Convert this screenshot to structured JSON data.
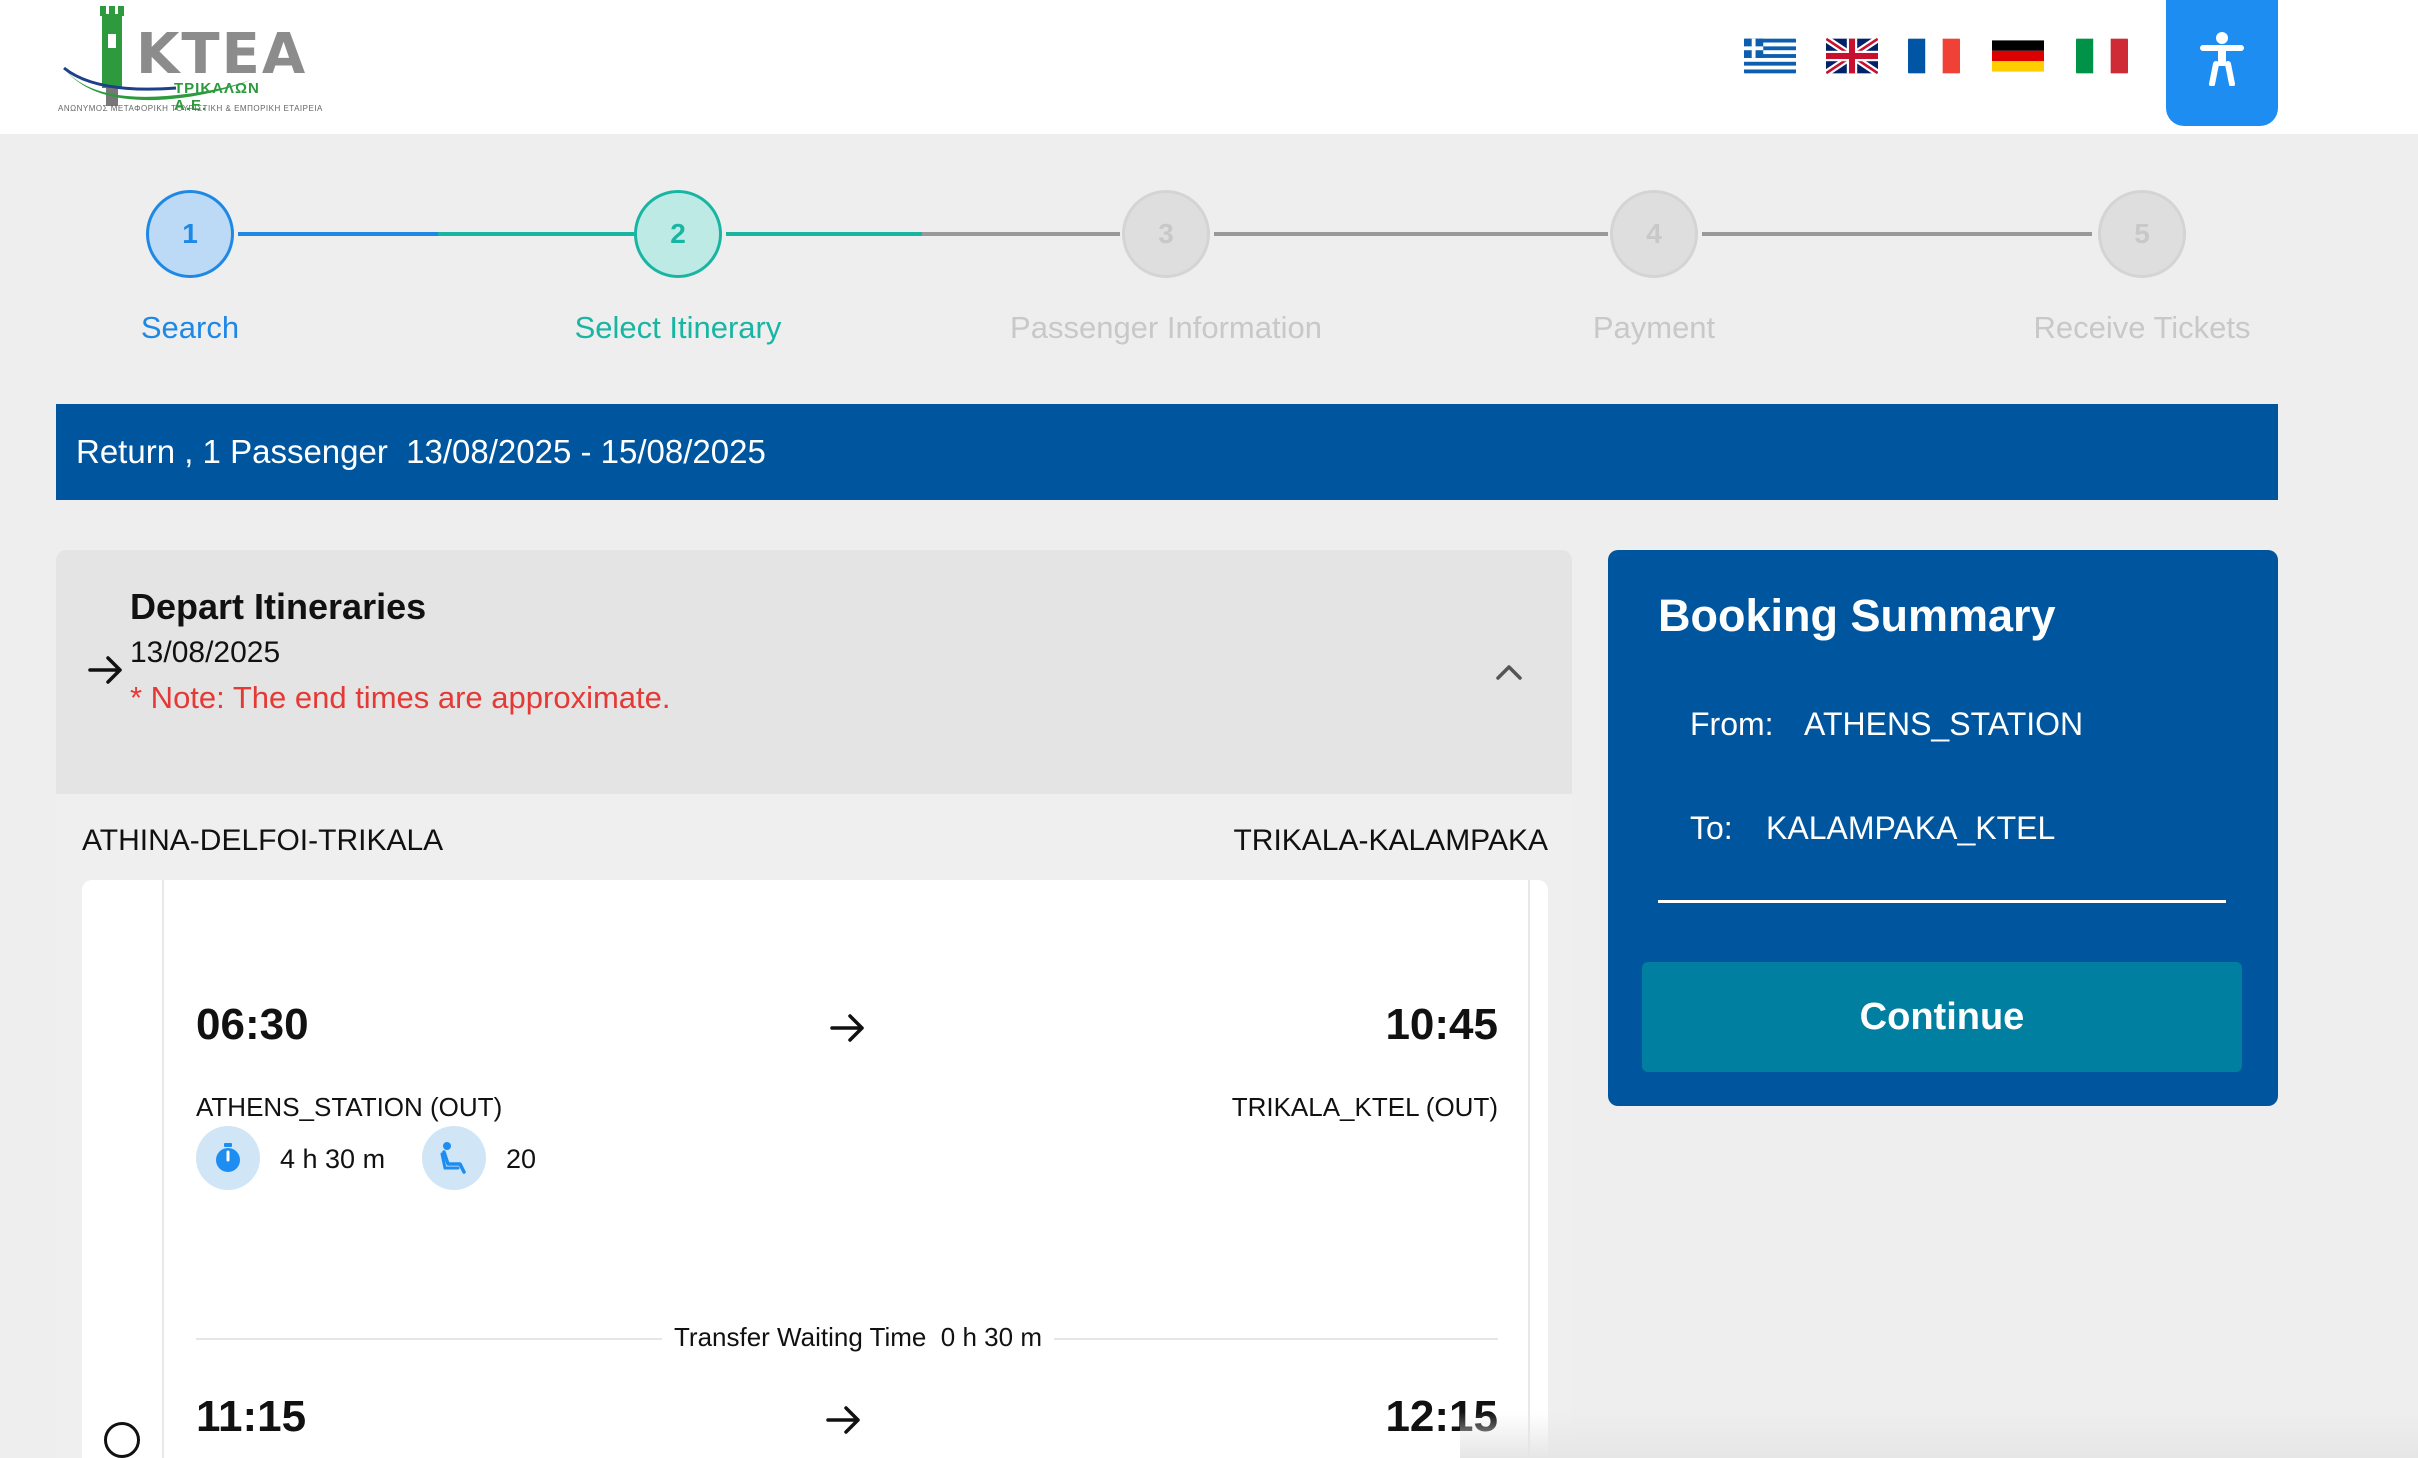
{
  "header": {
    "logo": {
      "name": "KTEA",
      "subtitle": "ΤΡΙΚΑΛΩΝ Α.Ε.",
      "tagline": "ΑΝΩΝΥΜΟΣ ΜΕΤΑΦΟΡΙΚΗ ΤΟΥΡΙΣΤΙΚΗ & ΕΜΠΟΡΙΚΗ ΕΤΑΙΡΕΙΑ"
    },
    "languages": [
      "greek-flag-icon",
      "uk-flag-icon",
      "france-flag-icon",
      "germany-flag-icon",
      "italy-flag-icon"
    ],
    "accessibility_icon": "accessibility-icon"
  },
  "stepper": {
    "steps": [
      {
        "number": "1",
        "label": "Search",
        "state": "done",
        "color": "#1e88e5"
      },
      {
        "number": "2",
        "label": "Select Itinerary",
        "state": "active",
        "color": "#19b5a3"
      },
      {
        "number": "3",
        "label": "Passenger Information",
        "state": "pending",
        "color": "#cccccc"
      },
      {
        "number": "4",
        "label": "Payment",
        "state": "pending",
        "color": "#cccccc"
      },
      {
        "number": "5",
        "label": "Receive Tickets",
        "state": "pending",
        "color": "#cccccc"
      }
    ]
  },
  "trip": {
    "summary": "Return , 1 Passenger  13/08/2025 - 15/08/2025"
  },
  "depart": {
    "title": "Depart Itineraries",
    "date": "13/08/2025",
    "note": "* Note: The end times are approximate.",
    "route_left": "ATHINA-DELFOI-TRIKALA",
    "route_right": "TRIKALA-KALAMPAKA",
    "legs": [
      {
        "dep_time": "06:30",
        "arr_time": "10:45",
        "from": "ATHENS_STATION (OUT)",
        "to": "TRIKALA_KTEL (OUT)",
        "duration": "4 h 30 m",
        "seats": "20"
      },
      {
        "dep_time": "11:15",
        "arr_time": "12:15"
      }
    ],
    "transfer": "Transfer Waiting Time  0 h 30 m"
  },
  "summary": {
    "title": "Booking Summary",
    "from_label": "From:",
    "from_value": "ATHENS_STATION",
    "to_label": "To:",
    "to_value": "KALAMPAKA_KTEL",
    "continue_label": "Continue"
  },
  "colors": {
    "brand_blue": "#00569e",
    "accent_blue": "#1e8df2",
    "teal": "#19b5a3",
    "continue": "#007fa0",
    "note_red": "#e53935"
  }
}
